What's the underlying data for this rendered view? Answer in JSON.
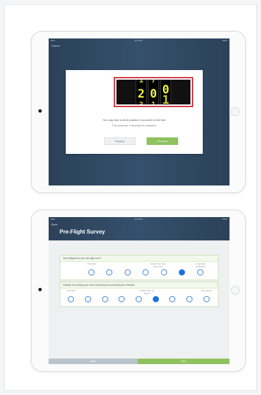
{
  "screen1": {
    "status": {
      "left": "iPad",
      "center": "9:41 AM",
      "right": "100%"
    },
    "cancel_label": "Cancel",
    "counter": {
      "reels": [
        {
          "prev": "1",
          "current": "2",
          "next": "3"
        },
        {
          "prev": "7",
          "current": "0",
          "next": "1"
        },
        {
          "current": "0",
          "next": "1"
        }
      ]
    },
    "message": "You may take a short practice or proceed to the test.",
    "submessage": "This screener 3 minutes to complete.",
    "practice_label": "Practice",
    "proceed_label": "Proceed",
    "colors": {
      "accent_green": "#8ec25e",
      "highlight_red": "#d33a4a",
      "counter_yellow": "#f2f23a"
    }
  },
  "screen2": {
    "status": {
      "left": "iPad",
      "center": "9:41 AM",
      "right": "100%"
    },
    "back_label": "Back",
    "title": "Pre-Flight Survey",
    "questions": [
      {
        "text": "How fatigued do you feel right now?",
        "labels": [
          "Fully alert",
          "A little tired, less than fresh",
          "Completely exhausted"
        ],
        "options": 7,
        "selected": 6
      },
      {
        "text": "Indicate how sleepy you have felt during the preceding five minutes:",
        "labels": [
          "Very alert",
          "Neither alert nor sleepy",
          "Very sleepy"
        ],
        "options": 9,
        "selected": 5
      }
    ],
    "back_button_label": "Back",
    "next_button_label": "Next",
    "colors": {
      "selected_radio": "#1e6fe0",
      "next_green": "#8ec25e"
    }
  }
}
